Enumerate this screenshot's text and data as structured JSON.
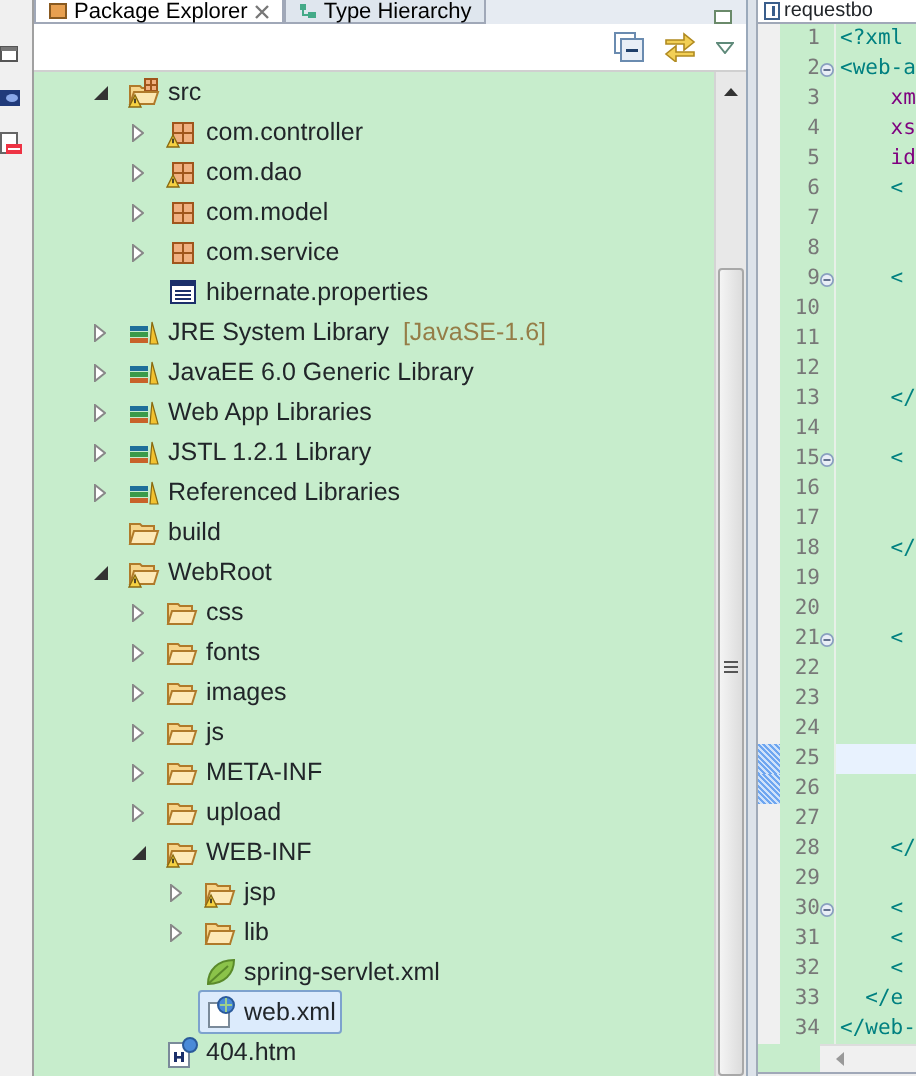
{
  "explorer": {
    "tabs": [
      {
        "label": "Package Explorer",
        "selected": true
      },
      {
        "label": "Type Hierarchy",
        "selected": false
      }
    ],
    "tree": [
      {
        "label": "src",
        "kind": "source-folder",
        "warning": true,
        "expanded": true,
        "selected": false,
        "children": [
          {
            "label": "com.controller",
            "kind": "package",
            "warning": true,
            "expanded": false,
            "selected": false
          },
          {
            "label": "com.dao",
            "kind": "package",
            "warning": true,
            "expanded": false,
            "selected": false
          },
          {
            "label": "com.model",
            "kind": "package",
            "warning": false,
            "expanded": false,
            "selected": false
          },
          {
            "label": "com.service",
            "kind": "package",
            "warning": false,
            "expanded": false,
            "selected": false
          },
          {
            "label": "hibernate.properties",
            "kind": "properties-file",
            "warning": false,
            "selected": false
          }
        ]
      },
      {
        "label": "JRE System Library",
        "decoration": "[JavaSE-1.6]",
        "kind": "library",
        "warning": false,
        "expanded": false,
        "selected": false
      },
      {
        "label": "JavaEE 6.0 Generic Library",
        "kind": "library",
        "warning": false,
        "expanded": false,
        "selected": false
      },
      {
        "label": "Web App Libraries",
        "kind": "library",
        "warning": false,
        "expanded": false,
        "selected": false
      },
      {
        "label": "JSTL 1.2.1 Library",
        "kind": "library",
        "warning": false,
        "expanded": false,
        "selected": false
      },
      {
        "label": "Referenced Libraries",
        "kind": "library",
        "warning": false,
        "expanded": false,
        "selected": false
      },
      {
        "label": "build",
        "kind": "folder",
        "warning": false,
        "selected": false
      },
      {
        "label": "WebRoot",
        "kind": "folder",
        "warning": true,
        "expanded": true,
        "selected": false,
        "children": [
          {
            "label": "css",
            "kind": "folder",
            "warning": false,
            "expanded": false,
            "selected": false
          },
          {
            "label": "fonts",
            "kind": "folder",
            "warning": false,
            "expanded": false,
            "selected": false
          },
          {
            "label": "images",
            "kind": "folder",
            "warning": false,
            "expanded": false,
            "selected": false
          },
          {
            "label": "js",
            "kind": "folder",
            "warning": false,
            "expanded": false,
            "selected": false
          },
          {
            "label": "META-INF",
            "kind": "folder",
            "warning": false,
            "expanded": false,
            "selected": false
          },
          {
            "label": "upload",
            "kind": "folder",
            "warning": false,
            "expanded": false,
            "selected": false
          },
          {
            "label": "WEB-INF",
            "kind": "folder",
            "warning": true,
            "expanded": true,
            "selected": false,
            "children": [
              {
                "label": "jsp",
                "kind": "folder",
                "warning": true,
                "expanded": false,
                "selected": false
              },
              {
                "label": "lib",
                "kind": "folder",
                "warning": false,
                "expanded": false,
                "selected": false
              },
              {
                "label": "spring-servlet.xml",
                "kind": "spring-file",
                "warning": false,
                "selected": false
              },
              {
                "label": "web.xml",
                "kind": "xml-file",
                "warning": false,
                "selected": true
              }
            ]
          },
          {
            "label": "404.htm",
            "kind": "html-file",
            "warning": false,
            "selected": false
          }
        ]
      }
    ]
  },
  "editor": {
    "tab": "requestbo",
    "lines": [
      {
        "number": "1",
        "code": "<?xml",
        "fold": false,
        "current": false,
        "annotated": false
      },
      {
        "number": "2",
        "code": "<web-a",
        "fold": true,
        "current": false,
        "annotated": false
      },
      {
        "number": "3",
        "code": "    xm",
        "fold": false,
        "current": false,
        "annotated": false
      },
      {
        "number": "4",
        "code": "    xs",
        "fold": false,
        "current": false,
        "annotated": false
      },
      {
        "number": "5",
        "code": "    id",
        "fold": false,
        "current": false,
        "annotated": false
      },
      {
        "number": "6",
        "code": "    <",
        "fold": false,
        "current": false,
        "annotated": false
      },
      {
        "number": "7",
        "fold": false,
        "current": false,
        "annotated": false
      },
      {
        "number": "8",
        "fold": false,
        "current": false,
        "annotated": false
      },
      {
        "number": "9",
        "code": "    <",
        "fold": true,
        "current": false,
        "annotated": false
      },
      {
        "number": "10",
        "fold": false,
        "current": false,
        "annotated": false
      },
      {
        "number": "11",
        "fold": false,
        "current": false,
        "annotated": false
      },
      {
        "number": "12",
        "fold": false,
        "current": false,
        "annotated": false
      },
      {
        "number": "13",
        "code": "    </",
        "fold": false,
        "current": false,
        "annotated": false
      },
      {
        "number": "14",
        "fold": false,
        "current": false,
        "annotated": false
      },
      {
        "number": "15",
        "code": "    <",
        "fold": true,
        "current": false,
        "annotated": false
      },
      {
        "number": "16",
        "fold": false,
        "current": false,
        "annotated": false
      },
      {
        "number": "17",
        "fold": false,
        "current": false,
        "annotated": false
      },
      {
        "number": "18",
        "code": "    </",
        "fold": false,
        "current": false,
        "annotated": false
      },
      {
        "number": "19",
        "fold": false,
        "current": false,
        "annotated": false
      },
      {
        "number": "20",
        "fold": false,
        "current": false,
        "annotated": false
      },
      {
        "number": "21",
        "code": "    <",
        "fold": true,
        "current": false,
        "annotated": false
      },
      {
        "number": "22",
        "fold": false,
        "current": false,
        "annotated": false
      },
      {
        "number": "23",
        "fold": false,
        "current": false,
        "annotated": false
      },
      {
        "number": "24",
        "fold": false,
        "current": false,
        "annotated": false
      },
      {
        "number": "25",
        "fold": false,
        "current": true,
        "annotated": true
      },
      {
        "number": "26",
        "fold": false,
        "current": false,
        "annotated": true
      },
      {
        "number": "27",
        "fold": false,
        "current": false,
        "annotated": false
      },
      {
        "number": "28",
        "code": "    </",
        "fold": false,
        "current": false,
        "annotated": false
      },
      {
        "number": "29",
        "fold": false,
        "current": false,
        "annotated": false
      },
      {
        "number": "30",
        "code": "    <",
        "fold": true,
        "current": false,
        "annotated": false
      },
      {
        "number": "31",
        "code": "    <",
        "fold": false,
        "current": false,
        "annotated": false
      },
      {
        "number": "32",
        "code": "    <",
        "fold": false,
        "current": false,
        "annotated": false
      },
      {
        "number": "33",
        "code": "  </e",
        "fold": false,
        "current": false,
        "annotated": false
      },
      {
        "number": "34",
        "code": "</web-",
        "fold": false,
        "current": false,
        "annotated": false
      }
    ]
  }
}
